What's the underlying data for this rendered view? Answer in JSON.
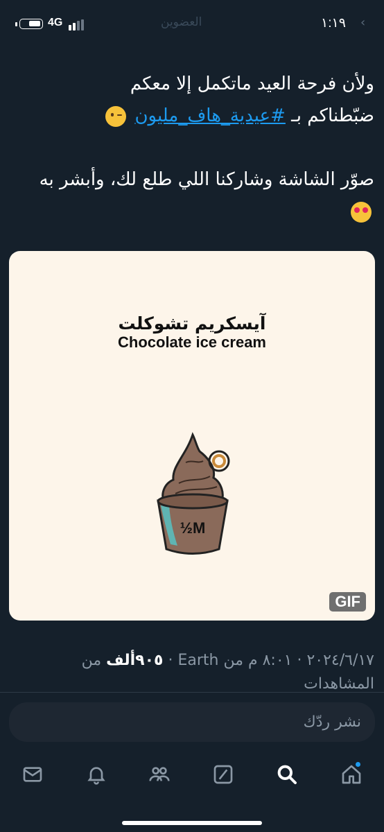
{
  "status_bar": {
    "time": "١:١٩",
    "network": "4G",
    "back_glyph": "‹",
    "faded_header": "العضوين"
  },
  "tweet": {
    "line1": "ولأن فرحة العيد ماتكمل إلا معكم",
    "line2_prefix": "ضبّطناكم بـ ",
    "hashtag": "#عيدية_هاف_مليون",
    "line3": "صوّر الشاشة وشاركنا اللي طلع لك، وأبشر به",
    "emoji_1": "winking-face-icon",
    "emoji_2": "heart-eyes-face-icon"
  },
  "media": {
    "title_ar": "آيسكريم تشوكلت",
    "title_en": "Chocolate ice cream",
    "cup_logo": "½M",
    "badge": "GIF",
    "colors": {
      "background": "#fdf5ea",
      "ice_cream": "#8a6a5a",
      "cup_accent": "#5fb4b2"
    }
  },
  "meta": {
    "date_time": "٢٠٢٤/٦/١٧ · ٨:٠١ م من Earth · ",
    "views_count": "٩٠٥ألف",
    "views_label": " من المشاهدات"
  },
  "reply": {
    "placeholder": "نشر ردّك"
  },
  "nav": {
    "items": [
      "mail-icon",
      "bell-icon",
      "communities-icon",
      "grok-icon",
      "search-icon",
      "home-icon"
    ],
    "accent": "#1d9bf0"
  },
  "theme": {
    "background": "#15202b",
    "text": "#ffffff",
    "muted": "#8b98a5",
    "link": "#1d9bf0"
  }
}
